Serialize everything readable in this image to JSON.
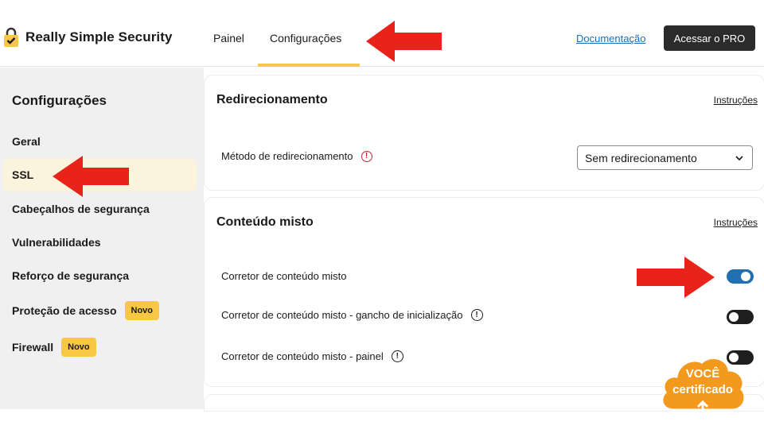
{
  "header": {
    "brand": "Really Simple Security",
    "tabs": [
      {
        "label": "Painel"
      },
      {
        "label": "Configurações"
      }
    ],
    "doc_link": "Documentação",
    "pro_button": "Acessar o PRO"
  },
  "sidebar": {
    "title": "Configurações",
    "items": [
      {
        "label": "Geral"
      },
      {
        "label": "SSL"
      },
      {
        "label": "Cabeçalhos de segurança"
      },
      {
        "label": "Vulnerabilidades"
      },
      {
        "label": "Reforço de segurança"
      },
      {
        "label": "Proteção de acesso",
        "badge": "Novo"
      },
      {
        "label": "Firewall",
        "badge": "Novo"
      }
    ]
  },
  "redirect_card": {
    "title": "Redirecionamento",
    "link": "Instruções",
    "row_label": "Método de redirecionamento",
    "select_value": "Sem redirecionamento"
  },
  "mixed_card": {
    "title": "Conteúdo misto",
    "link": "Instruções",
    "rows": [
      {
        "label": "Corretor de conteúdo misto",
        "enabled": true
      },
      {
        "label": "Corretor de conteúdo misto - gancho de inicialização",
        "enabled": false
      },
      {
        "label": "Corretor de conteúdo misto - painel",
        "enabled": false
      }
    ]
  },
  "cert_badge": {
    "line1": "VOCÊ",
    "line2": "certificado"
  },
  "colors": {
    "accent_yellow": "#f6c74b",
    "toggle_on": "#2270b2",
    "annotation_arrow": "#e8231a",
    "badge_orange": "#f39a1e"
  },
  "icons": {
    "brand": "lock-check-icon",
    "warning": "exclamation-circle-icon",
    "info": "exclamation-circle-outline-icon",
    "select": "chevron-down-icon"
  }
}
